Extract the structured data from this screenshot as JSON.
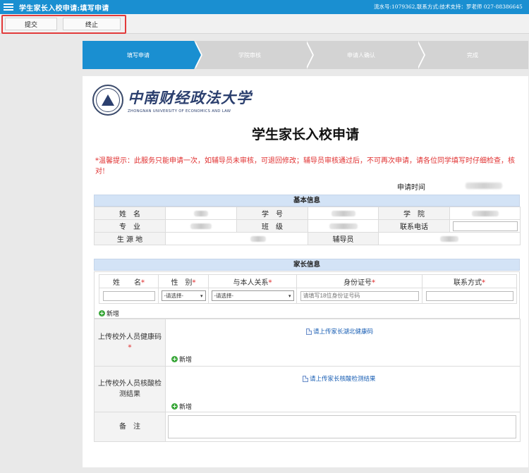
{
  "app": {
    "title": "学生家长入校申请:填写申请",
    "serial_text": "流水号:1079362,联系方式:技术支持：罗老师 027-88386645"
  },
  "toolbar": {
    "submit_label": "提交",
    "stop_label": "终止"
  },
  "steps": [
    "填写申请",
    "学院审核",
    "申请人确认",
    "完成"
  ],
  "logo": {
    "cn_name": "中南财经政法大学",
    "en_name": "ZHONGNAN UNIVERSITY OF ECONOMICS AND LAW"
  },
  "form": {
    "title": "学生家长入校申请",
    "notice": "*温馨提示：此服务只能申请一次，如辅导员未审核，可退回修改；辅导员审核通过后，不可再次申请，请各位同学填写时仔细检查，核对!",
    "apply_time_label": "申请时间"
  },
  "basic": {
    "header": "基本信息",
    "name_label": "姓　名",
    "student_id_label": "学　号",
    "college_label": "学　院",
    "major_label": "专　业",
    "class_label": "班　级",
    "phone_label": "联系电话",
    "origin_label": "生 源 地",
    "counselor_label": "辅导员",
    "phone_value": ""
  },
  "parent": {
    "header": "家长信息",
    "col_name": "姓　　名",
    "col_gender": "性　别",
    "col_relation": "与本人关系",
    "col_id": "身份证号",
    "col_contact": "联系方式",
    "required_mark": "*",
    "select_placeholder": "-请选择-",
    "id_placeholder": "请填写18位身份证号码",
    "add_label": "新增"
  },
  "uploads": {
    "health_label": "上传校外人员健康码",
    "health_link": "请上传家长湖北健康码",
    "nucleic_label": "上传校外人员核酸检测结果",
    "nucleic_link": "请上传家长核酸检测结果",
    "add_label": "新增",
    "remark_label": "备　注"
  },
  "colors": {
    "primary": "#1a8fd1",
    "section_header": "#d3e3f6",
    "warning_text": "#e03030",
    "highlight_border": "#e23a3a",
    "add_icon": "#3aa73a"
  }
}
